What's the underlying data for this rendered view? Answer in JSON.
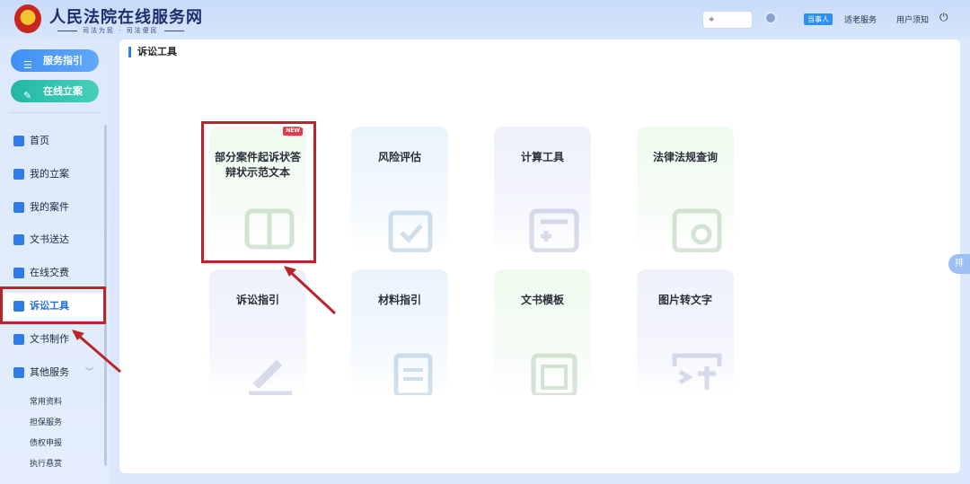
{
  "header": {
    "site_title": "人民法院在线服务网",
    "slogan": "司法为民 · 司法便民",
    "role_badge": "当事人",
    "elder_service": "适老服务",
    "user_notice": "用户须知"
  },
  "sidebar": {
    "guide_button": "服务指引",
    "file_case_button": "在线立案",
    "menu": [
      {
        "label": "首页"
      },
      {
        "label": "我的立案"
      },
      {
        "label": "我的案件"
      },
      {
        "label": "文书送达"
      },
      {
        "label": "在线交费"
      },
      {
        "label": "诉讼工具"
      },
      {
        "label": "文书制作"
      },
      {
        "label": "其他服务"
      }
    ],
    "sub_menu": [
      "常用资料",
      "担保服务",
      "债权申报",
      "执行悬赏"
    ]
  },
  "content": {
    "title": "诉讼工具",
    "cards": [
      {
        "label": "部分案件起诉状答辩状示范文本",
        "badge": "NEW"
      },
      {
        "label": "风险评估"
      },
      {
        "label": "计算工具"
      },
      {
        "label": "法律法规查询"
      },
      {
        "label": "诉讼指引"
      },
      {
        "label": "材料指引"
      },
      {
        "label": "文书模板"
      },
      {
        "label": "图片转文字"
      }
    ]
  },
  "side_tab": "排",
  "icons": {
    "location": "location-pin-icon",
    "avatar": "user-avatar-icon",
    "power": "power-icon"
  },
  "colors": {
    "accent_blue": "#2d7ef0",
    "guide_button": "#3f8ff4",
    "file_case_button": "#23b7a6",
    "annotation_red": "#b8262c"
  }
}
